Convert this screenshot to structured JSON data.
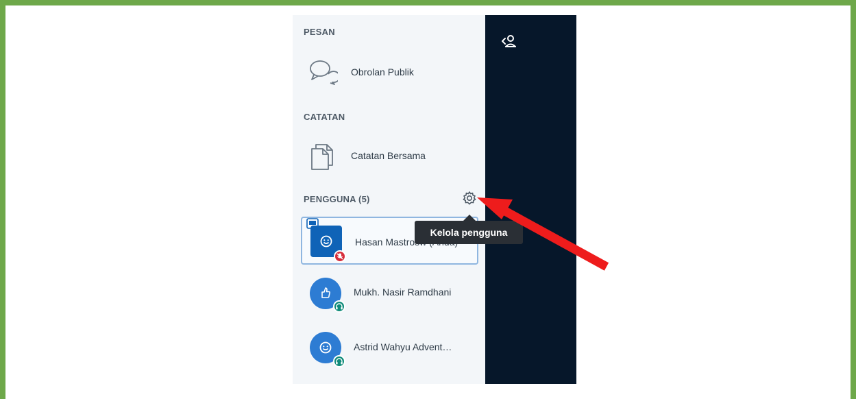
{
  "messages": {
    "section_title": "PESAN",
    "public_chat": {
      "label": "Obrolan Publik",
      "icon": "chat-bubbles-icon"
    }
  },
  "notes": {
    "section_title": "CATATAN",
    "shared_notes": {
      "label": "Catatan Bersama",
      "icon": "document-icon"
    }
  },
  "users": {
    "section_title": "PENGGUNA (5)",
    "settings_icon": "gear-icon",
    "list": [
      {
        "name": "Hasan Mastrosw (Anda)",
        "avatar": "smiley-icon",
        "badge": "mic-muted-icon",
        "badge_color": "#d62d3b",
        "role_icon": "presenter-icon",
        "selected": true
      },
      {
        "name": "Mukh. Nasir Ramdhani",
        "avatar": "thumbs-up-icon",
        "badge": "headphones-icon",
        "badge_color": "#0f8b7a",
        "selected": false
      },
      {
        "name": "Astrid Wahyu Advent…",
        "avatar": "smiley-icon",
        "badge": "headphones-icon",
        "badge_color": "#0f8b7a",
        "selected": false
      }
    ]
  },
  "toggle_user_list_icon": "user-list-toggle-icon",
  "tooltip": {
    "text": "Kelola pengguna"
  },
  "annotation": {
    "arrow_color": "#ee1c1c",
    "frame_color": "#6ea84a"
  }
}
